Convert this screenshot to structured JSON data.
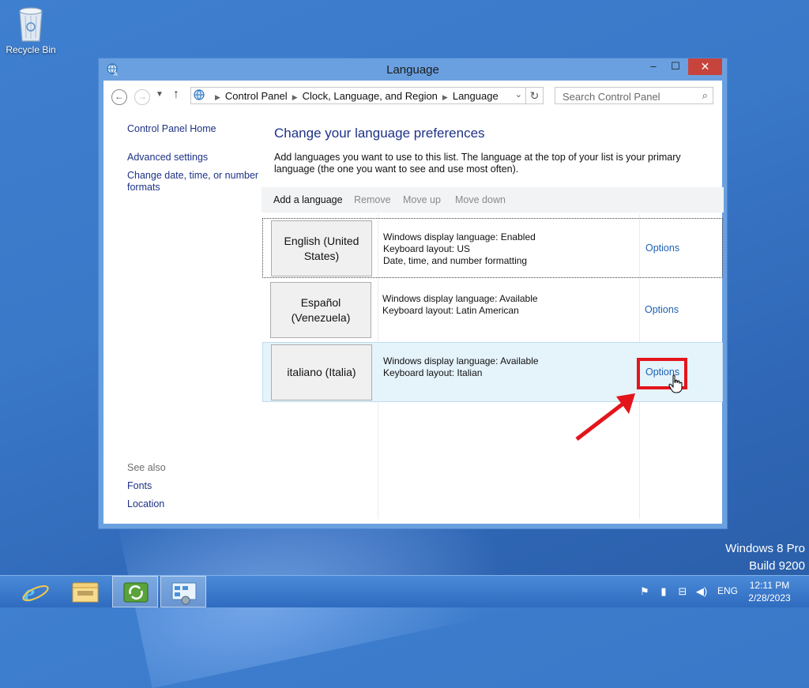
{
  "desktop": {
    "recycle_bin_label": "Recycle Bin"
  },
  "window": {
    "title": "Language",
    "buttons": {
      "minimize": "–",
      "maximize": "☐",
      "close": "✕"
    }
  },
  "address_bar": {
    "crumbs": [
      "Control Panel",
      "Clock, Language, and Region",
      "Language"
    ],
    "search_placeholder": "Search Control Panel"
  },
  "left_nav": {
    "home": "Control Panel Home",
    "advanced": "Advanced settings",
    "change_formats": "Change date, time, or number formats",
    "see_also": "See also",
    "fonts": "Fonts",
    "location": "Location"
  },
  "main": {
    "heading": "Change your language preferences",
    "description": "Add languages you want to use to this list. The language at the top of your list is your primary language (the one you want to see and use most often).",
    "toolbar": {
      "add": "Add a language",
      "remove": "Remove",
      "move_up": "Move up",
      "move_down": "Move down"
    },
    "languages": [
      {
        "name": "English (United States)",
        "lines": [
          "Windows display language: Enabled",
          "Keyboard layout: US",
          "Date, time, and number formatting"
        ],
        "options": "Options"
      },
      {
        "name": "Español (Venezuela)",
        "lines": [
          "Windows display language: Available",
          "Keyboard layout: Latin American"
        ],
        "options": "Options"
      },
      {
        "name": "italiano (Italia)",
        "lines": [
          "Windows display language: Available",
          "Keyboard layout: Italian"
        ],
        "options": "Options"
      }
    ]
  },
  "watermark": {
    "edition": "Windows 8 Pro",
    "build": "Build 9200"
  },
  "taskbar": {
    "language_indicator": "ENG",
    "time": "12:11 PM",
    "date": "2/28/2023"
  },
  "colors": {
    "link": "#1e3287",
    "options_link": "#1e61b3",
    "highlight_box": "#e3151b",
    "selected_row": "#e5f3fb"
  }
}
